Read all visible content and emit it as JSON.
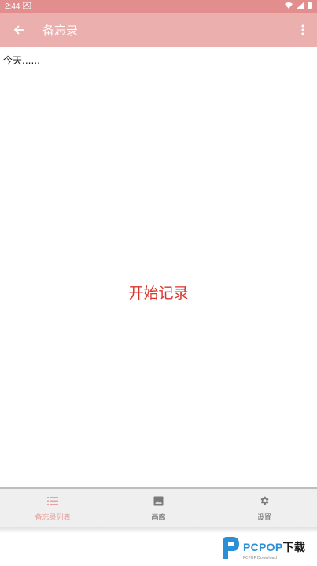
{
  "status": {
    "time": "2:44"
  },
  "app_bar": {
    "title": "备忘录"
  },
  "memo": {
    "text": "今天......"
  },
  "start_button": {
    "label": "开始记录"
  },
  "bottom_nav": {
    "items": [
      {
        "label": "备忘录列表",
        "icon": "list-icon",
        "active": true
      },
      {
        "label": "画廊",
        "icon": "image-icon",
        "active": false
      },
      {
        "label": "设置",
        "icon": "gear-icon",
        "active": false
      }
    ]
  },
  "watermark": {
    "brand_a": "PCPOP",
    "brand_b": "下载",
    "sub": "PCPOP Download"
  },
  "colors": {
    "status_bar": "#e38e8e",
    "app_bar": "#ebb0ae",
    "accent_text": "#d9352c",
    "nav_active": "#e9a0a0"
  }
}
